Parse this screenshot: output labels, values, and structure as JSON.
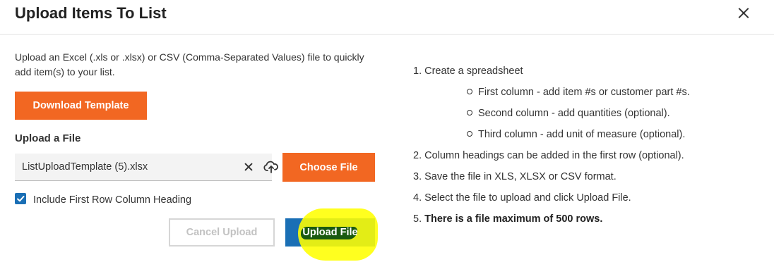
{
  "dialog": {
    "title": "Upload Items To List",
    "intro": "Upload an Excel (.xls or .xlsx) or CSV (Comma-Separated Values) file to quickly add item(s) to your list.",
    "download_template_label": "Download Template",
    "upload_label": "Upload a File",
    "file_name": "ListUploadTemplate (5).xlsx",
    "choose_file_label": "Choose File",
    "include_heading_label": "Include First Row Column Heading",
    "include_heading_checked": true,
    "cancel_label": "Cancel Upload",
    "upload_file_label": "Upload File"
  },
  "instructions": {
    "step1": "1. Create a spreadsheet",
    "sub1": "First column - add item #s or customer part #s.",
    "sub2": "Second column - add quantities (optional).",
    "sub3": "Third column - add unit of measure (optional).",
    "step2": "2. Column headings can be added in the first row (optional).",
    "step3": "3. Save the file in XLS, XLSX or CSV format.",
    "step4": "4. Select the file to upload and click Upload File.",
    "step5_num": "5.",
    "step5_text": "There is a file maximum of 500 rows."
  },
  "colors": {
    "accent_orange": "#f26722",
    "primary_blue": "#1a6fb5",
    "highlight_yellow": "#ffff00"
  },
  "icons": [
    "close-icon",
    "clear-icon",
    "cloud-upload-icon",
    "checkbox-checked-icon"
  ]
}
